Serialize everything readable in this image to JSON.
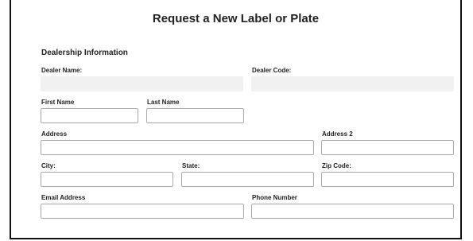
{
  "form": {
    "title": "Request a New Label or Plate",
    "section_title": "Dealership Information",
    "fields": {
      "dealer_name": {
        "label": "Dealer Name:",
        "value": ""
      },
      "dealer_code": {
        "label": "Dealer Code:",
        "value": ""
      },
      "first_name": {
        "label": "First Name",
        "value": ""
      },
      "last_name": {
        "label": "Last Name",
        "value": ""
      },
      "address": {
        "label": "Address",
        "value": ""
      },
      "address2": {
        "label": "Address 2",
        "value": ""
      },
      "city": {
        "label": "City:",
        "value": ""
      },
      "state": {
        "label": "State:",
        "value": ""
      },
      "zip": {
        "label": "Zip Code:",
        "value": ""
      },
      "email": {
        "label": "Email Address",
        "value": ""
      },
      "phone": {
        "label": "Phone Number",
        "value": ""
      }
    }
  }
}
